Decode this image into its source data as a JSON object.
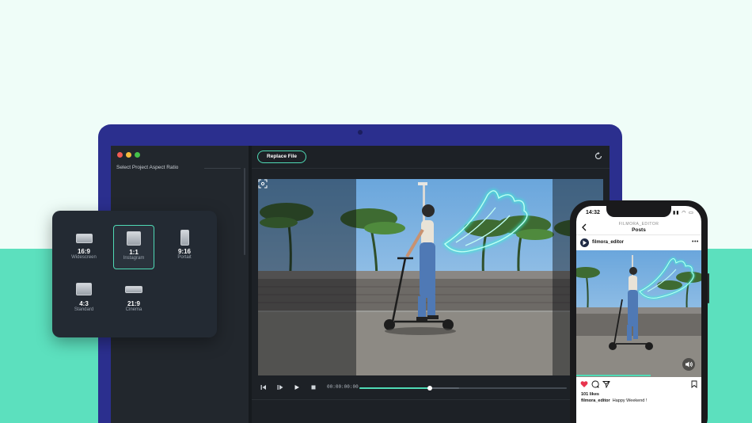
{
  "editor": {
    "panel_title": "Select Project Aspect Ratio",
    "replace_button": "Replace File",
    "timecode": "00:00:00:00",
    "playback_progress": 0.34,
    "playback_buffered": 0.48
  },
  "aspect_ratios": [
    {
      "value": "16:9",
      "name": "Widescreen",
      "selected": false
    },
    {
      "value": "1:1",
      "name": "Instagram",
      "selected": true
    },
    {
      "value": "9:16",
      "name": "Portait",
      "selected": false
    },
    {
      "value": "4:3",
      "name": "Standard",
      "selected": false
    },
    {
      "value": "21:9",
      "name": "Cinema",
      "selected": false
    }
  ],
  "phone": {
    "time": "14:32",
    "account_caps": "FILMORA_EDITOR",
    "header_title": "Posts",
    "username": "filmora_editor",
    "likes": "101 likes",
    "caption_user": "filmora_editor",
    "caption_text": "Happy Weekend !"
  },
  "colors": {
    "accent": "#4fdab5",
    "laptop_frame": "#2b2f8e",
    "background_top": "#effdf8",
    "background_bottom": "#5ce0be",
    "like_heart": "#e8344e"
  }
}
